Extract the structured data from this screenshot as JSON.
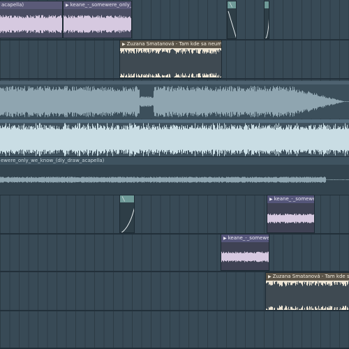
{
  "clips": [
    {
      "id": "a",
      "title": "acapella)"
    },
    {
      "id": "b",
      "title": "keane_-_somewere_only_we_"
    },
    {
      "id": "c",
      "title": "Zuzana Smatanová - Tam kde sa neumiera"
    },
    {
      "id": "d",
      "title": "ewere_only_we_know_(diy_draw_acapella)"
    },
    {
      "id": "e",
      "title": "keane_-_somewere"
    },
    {
      "id": "f",
      "title": "keane_-_somewere..."
    },
    {
      "id": "g",
      "title": "Zuzana Smatanová - Tam kde sa neumiera"
    }
  ],
  "colors": {
    "lavender": "#d6c9e0",
    "cream": "#ece4d4",
    "slate": "#8fa5b0",
    "ice": "#c9dde4",
    "teal": "#6f9a98"
  }
}
